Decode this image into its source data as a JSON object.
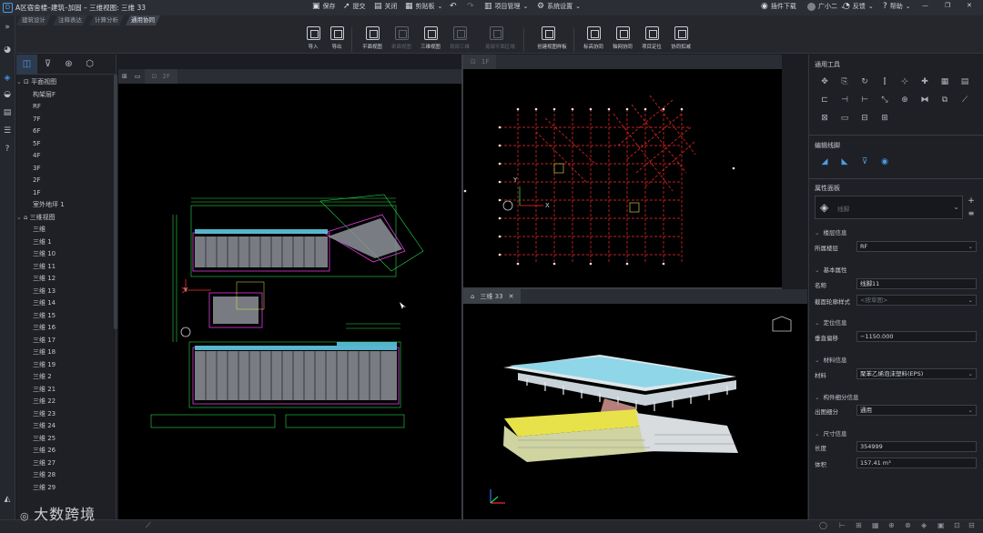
{
  "window": {
    "title": "A区宿舍楼–建筑–加固 – 三维视图: 三维 33"
  },
  "quick_actions": [
    {
      "label": "保存",
      "icon": "save-icon"
    },
    {
      "label": "提交",
      "icon": "submit-icon"
    },
    {
      "label": "关闭",
      "icon": "close-file-icon"
    },
    {
      "label": "剪贴板",
      "icon": "clipboard-icon"
    },
    {
      "label": "项目管理",
      "icon": "project-icon"
    },
    {
      "label": "系统设置",
      "icon": "settings-icon"
    }
  ],
  "top_right": {
    "plugin": "插件下载",
    "user": "广小二",
    "feedback": "反馈",
    "help": "帮助"
  },
  "module_tabs": [
    "建筑设计",
    "注释表达",
    "计算分析",
    "通用协同"
  ],
  "ribbon": [
    {
      "label": "导入",
      "enabled": true
    },
    {
      "label": "导出",
      "enabled": true
    },
    {
      "label": "平面视图",
      "enabled": true
    },
    {
      "label": "剖面视图",
      "enabled": false
    },
    {
      "label": "三维视图",
      "enabled": true
    },
    {
      "label": "局部三维",
      "enabled": false
    },
    {
      "label": "局部平面区域",
      "enabled": false
    },
    {
      "label": "创建视图样板",
      "enabled": true
    },
    {
      "label": "标高协同",
      "enabled": true
    },
    {
      "label": "轴网协同",
      "enabled": true
    },
    {
      "label": "项目定位",
      "enabled": true
    },
    {
      "label": "协同扣减",
      "enabled": true
    }
  ],
  "tree": {
    "plan_root": "平面视图",
    "plans": [
      "构架层F",
      "RF",
      "7F",
      "6F",
      "5F",
      "4F",
      "3F",
      "2F",
      "1F",
      "室外地坪 1"
    ],
    "view3d_root": "三维视图",
    "views3d": [
      "三维",
      "三维 1",
      "三维 10",
      "三维 11",
      "三维 12",
      "三维 13",
      "三维 14",
      "三维 15",
      "三维 16",
      "三维 17",
      "三维 18",
      "三维 19",
      "三维 2",
      "三维 21",
      "三维 22",
      "三维 23",
      "三维 24",
      "三维 25",
      "三维 26",
      "三维 27",
      "三维 28",
      "三维 29"
    ]
  },
  "viewports": {
    "plan_left_tab": "2F",
    "plan_right_tab": "1F",
    "view3d_tab": "三维 33"
  },
  "right_panel": {
    "general_tools_title": "通用工具",
    "edit_lines_title": "编辑线脚",
    "props_title": "属性面板",
    "type_selector": "线脚",
    "sections": {
      "floor": {
        "title": "楼层信息",
        "label": "所属楼层",
        "value": "RF"
      },
      "basic": {
        "title": "基本属性",
        "name_label": "名称",
        "name_value": "线脚11",
        "profile_label": "截面轮廓样式",
        "profile_value": "<按草图>"
      },
      "position": {
        "title": "定位信息",
        "label": "垂直偏移",
        "value": "−1150.000"
      },
      "material": {
        "title": "材料信息",
        "label": "材料",
        "value": "聚苯乙烯泡沫塑料(EPS)"
      },
      "component": {
        "title": "构件细分信息",
        "label": "出图细分",
        "value": "通用"
      },
      "size": {
        "title": "尺寸信息",
        "length_label": "长度",
        "length_value": "354999",
        "volume_label": "体积",
        "volume_value": "157.41 m³"
      }
    }
  },
  "watermark": "大数跨境",
  "colors": {
    "accent": "#3d8fe0",
    "cad_red": "#ff2a2a",
    "cad_green": "#27d74a",
    "cad_magenta": "#e23be0",
    "model_yellow": "#e8e24a",
    "model_cyan": "#5ec8e0"
  }
}
